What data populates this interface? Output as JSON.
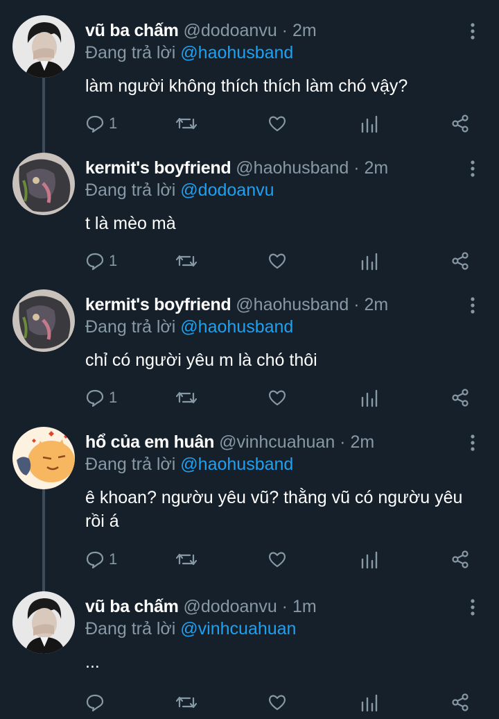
{
  "tweets": [
    {
      "name": "vũ ba chấm",
      "handle": "@dodoanvu",
      "time": "2m",
      "reply_prefix": "Đang trả lời",
      "reply_to": "@haohusband",
      "text": "làm người không thích thích làm chó vậy?",
      "reply_count": "1",
      "avatar_icon": "person-avatar"
    },
    {
      "name": "kermit's boyfriend",
      "handle": "@haohusband",
      "time": "2m",
      "reply_prefix": "Đang trả lời",
      "reply_to": "@dodoanvu",
      "text": "t là mèo mà",
      "reply_count": "1",
      "avatar_icon": "cat-avatar"
    },
    {
      "name": "kermit's boyfriend",
      "handle": "@haohusband",
      "time": "2m",
      "reply_prefix": "Đang trả lời",
      "reply_to": "@haohusband",
      "text": "chỉ có người yêu m là chó thôi",
      "reply_count": "1",
      "avatar_icon": "cat-avatar"
    },
    {
      "name": "hổ của em huân",
      "handle": "@vinhcuahuan",
      "time": "2m",
      "reply_prefix": "Đang trả lời",
      "reply_to": "@haohusband",
      "text": "ê khoan? ngườu yêu vũ? thằng vũ có ngườu yêu rồi á",
      "reply_count": "1",
      "avatar_icon": "tiger-avatar"
    },
    {
      "name": "vũ ba chấm",
      "handle": "@dodoanvu",
      "time": "1m",
      "reply_prefix": "Đang trả lời",
      "reply_to": "@vinhcuahuan",
      "text": "...",
      "reply_count": "",
      "avatar_icon": "person-avatar"
    }
  ],
  "separator": " · ",
  "colors": {
    "background": "#15202b",
    "text": "#ffffff",
    "secondary": "#8899a6",
    "link": "#1da1f2",
    "thread_line": "#3d4c5a"
  }
}
